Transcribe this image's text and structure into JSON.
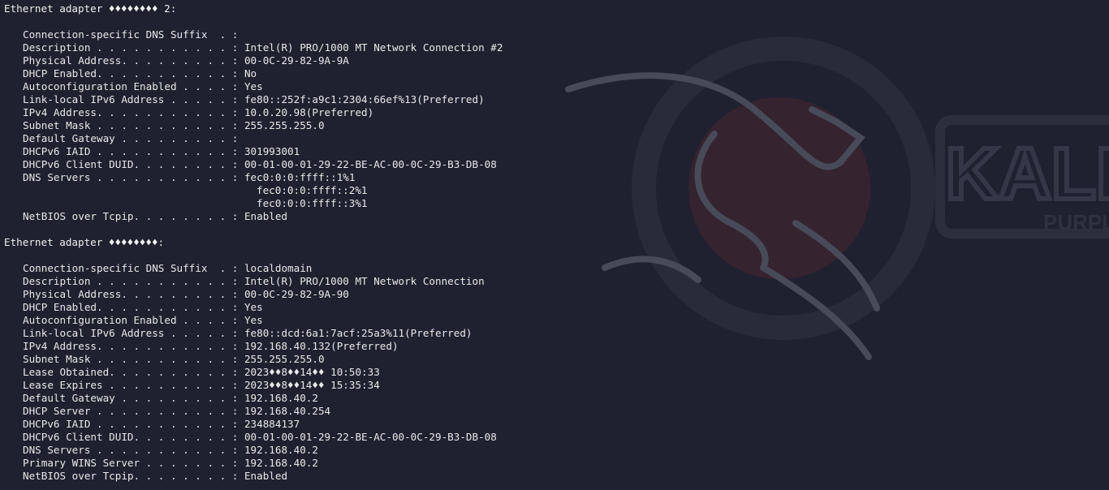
{
  "adapters": [
    {
      "header": "Ethernet adapter ♦♦♦♦♦♦♦♦ 2:",
      "rows": [
        {
          "label": "Connection-specific DNS Suffix  . :",
          "value": ""
        },
        {
          "label": "Description . . . . . . . . . . . :",
          "value": "Intel(R) PRO/1000 MT Network Connection #2"
        },
        {
          "label": "Physical Address. . . . . . . . . :",
          "value": "00-0C-29-82-9A-9A"
        },
        {
          "label": "DHCP Enabled. . . . . . . . . . . :",
          "value": "No"
        },
        {
          "label": "Autoconfiguration Enabled . . . . :",
          "value": "Yes"
        },
        {
          "label": "Link-local IPv6 Address . . . . . :",
          "value": "fe80::252f:a9c1:2304:66ef%13(Preferred)"
        },
        {
          "label": "IPv4 Address. . . . . . . . . . . :",
          "value": "10.0.20.98(Preferred)"
        },
        {
          "label": "Subnet Mask . . . . . . . . . . . :",
          "value": "255.255.255.0"
        },
        {
          "label": "Default Gateway . . . . . . . . . :",
          "value": ""
        },
        {
          "label": "DHCPv6 IAID . . . . . . . . . . . :",
          "value": "301993001"
        },
        {
          "label": "DHCPv6 Client DUID. . . . . . . . :",
          "value": "00-01-00-01-29-22-BE-AC-00-0C-29-B3-DB-08"
        },
        {
          "label": "DNS Servers . . . . . . . . . . . :",
          "value": "fec0:0:0:ffff::1%1"
        },
        {
          "label": "",
          "value": "fec0:0:0:ffff::2%1"
        },
        {
          "label": "",
          "value": "fec0:0:0:ffff::3%1"
        },
        {
          "label": "NetBIOS over Tcpip. . . . . . . . :",
          "value": "Enabled"
        }
      ]
    },
    {
      "header": "Ethernet adapter ♦♦♦♦♦♦♦♦:",
      "rows": [
        {
          "label": "Connection-specific DNS Suffix  . :",
          "value": "localdomain"
        },
        {
          "label": "Description . . . . . . . . . . . :",
          "value": "Intel(R) PRO/1000 MT Network Connection"
        },
        {
          "label": "Physical Address. . . . . . . . . :",
          "value": "00-0C-29-82-9A-90"
        },
        {
          "label": "DHCP Enabled. . . . . . . . . . . :",
          "value": "Yes"
        },
        {
          "label": "Autoconfiguration Enabled . . . . :",
          "value": "Yes"
        },
        {
          "label": "Link-local IPv6 Address . . . . . :",
          "value": "fe80::dcd:6a1:7acf:25a3%11(Preferred)"
        },
        {
          "label": "IPv4 Address. . . . . . . . . . . :",
          "value": "192.168.40.132(Preferred)"
        },
        {
          "label": "Subnet Mask . . . . . . . . . . . :",
          "value": "255.255.255.0"
        },
        {
          "label": "Lease Obtained. . . . . . . . . . :",
          "value": "2023♦♦8♦♦14♦♦ 10:50:33"
        },
        {
          "label": "Lease Expires . . . . . . . . . . :",
          "value": "2023♦♦8♦♦14♦♦ 15:35:34"
        },
        {
          "label": "Default Gateway . . . . . . . . . :",
          "value": "192.168.40.2"
        },
        {
          "label": "DHCP Server . . . . . . . . . . . :",
          "value": "192.168.40.254"
        },
        {
          "label": "DHCPv6 IAID . . . . . . . . . . . :",
          "value": "234884137"
        },
        {
          "label": "DHCPv6 Client DUID. . . . . . . . :",
          "value": "00-01-00-01-29-22-BE-AC-00-0C-29-B3-DB-08"
        },
        {
          "label": "DNS Servers . . . . . . . . . . . :",
          "value": "192.168.40.2"
        },
        {
          "label": "Primary WINS Server . . . . . . . :",
          "value": "192.168.40.2"
        },
        {
          "label": "NetBIOS over Tcpip. . . . . . . . :",
          "value": "Enabled"
        }
      ]
    }
  ],
  "wallpaper": {
    "logo_text": "KALI",
    "sub_text": "PURPLE",
    "colors": {
      "background": "#1f2130",
      "circle": "#2b2d3c",
      "disc": "#3a2633",
      "dragon": "#4a4d5c",
      "text": "#e9e9e9"
    }
  }
}
